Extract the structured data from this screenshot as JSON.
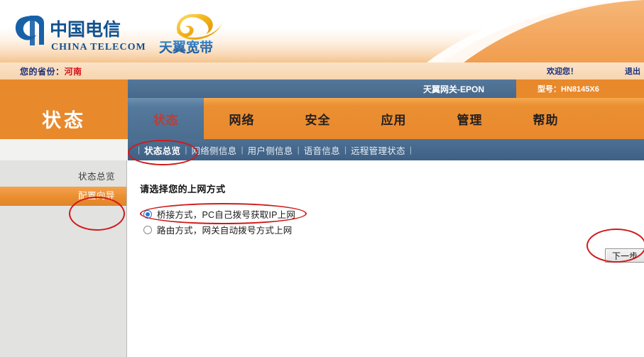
{
  "header": {
    "logo_primary_cn": "中国电信",
    "logo_primary_en": "CHINA TELECOM",
    "logo_secondary_cn": "天翼宽带",
    "province_label": "您的省份：",
    "province_value": "河南",
    "welcome": "欢迎您！",
    "logout": "退出"
  },
  "device": {
    "gateway_name": "天翼网关-EPON",
    "model_label": "型号：HN8145X6"
  },
  "nav": {
    "section_title": "状态",
    "tabs": [
      {
        "label": "状态",
        "active": true
      },
      {
        "label": "网络",
        "active": false
      },
      {
        "label": "安全",
        "active": false
      },
      {
        "label": "应用",
        "active": false
      },
      {
        "label": "管理",
        "active": false
      },
      {
        "label": "帮助",
        "active": false
      }
    ],
    "subnav": [
      {
        "label": "状态总览",
        "active": true
      },
      {
        "label": "网络侧信息",
        "active": false
      },
      {
        "label": "用户侧信息",
        "active": false
      },
      {
        "label": "语音信息",
        "active": false
      },
      {
        "label": "远程管理状态",
        "active": false
      }
    ],
    "subnav_separator": "|"
  },
  "sidebar": {
    "items": [
      {
        "label": "状态总览",
        "active": false
      },
      {
        "label": "配置向导",
        "active": true
      }
    ]
  },
  "main": {
    "title": "请选择您的上网方式",
    "options": [
      {
        "label": "桥接方式，PC自己拨号获取IP上网",
        "selected": true
      },
      {
        "label": "路由方式，网关自动拨号方式上网",
        "selected": false
      }
    ],
    "next_button": "下一步"
  },
  "colors": {
    "orange": "#e8892c",
    "steel_blue": "#4a6d90",
    "sidebar_bg": "#e2e2e0",
    "annotation_red": "#d01a1a",
    "province_value": "#d4121a",
    "header_text_blue": "#1a2f7a"
  },
  "annotations": [
    {
      "name": "subnav-status-overview-circle",
      "shape": "ellipse"
    },
    {
      "name": "sidebar-config-wizard-circle",
      "shape": "ellipse"
    },
    {
      "name": "bridge-option-circle",
      "shape": "ellipse"
    },
    {
      "name": "next-button-circle",
      "shape": "ellipse"
    }
  ]
}
